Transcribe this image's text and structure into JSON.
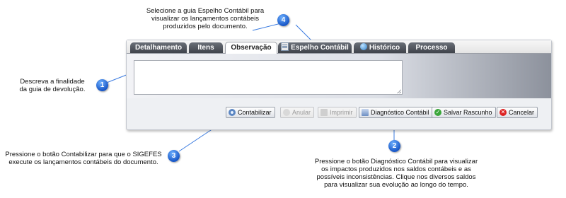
{
  "tabs": [
    {
      "label": "Detalhamento",
      "icon": "",
      "active": false
    },
    {
      "label": "Itens",
      "icon": "",
      "active": false
    },
    {
      "label": "Observação",
      "icon": "",
      "active": true
    },
    {
      "label": "Espelho Contábil",
      "icon": "document-list-icon",
      "active": false
    },
    {
      "label": "Histórico",
      "icon": "globe-icon",
      "active": false
    },
    {
      "label": "Processo",
      "icon": "",
      "active": false
    }
  ],
  "observation": {
    "value": ""
  },
  "buttons": {
    "contabilizar": "Contabilizar",
    "anular": "Anular",
    "imprimir": "Imprimir",
    "diagnostico": "Diagnóstico Contábil",
    "salvar_rascunho": "Salvar Rascunho",
    "cancelar": "Cancelar"
  },
  "callouts": {
    "c1": {
      "number": "1",
      "text_1": "Descreva a finalidade",
      "text_2": "da guia de devolução."
    },
    "c2": {
      "number": "2",
      "text_1": "Pressione o botão Diagnóstico Contábil para visualizar",
      "text_2": "os impactos produzidos nos saldos contábeis e as",
      "text_3": "possíveis inconsistências. Clique nos diversos saldos",
      "text_4": "para visualizar sua evolução ao longo do tempo."
    },
    "c3": {
      "number": "3",
      "text_1": "Pressione o botão Contabilizar para que o SIGEFES",
      "text_2": "execute os lançamentos contábeis do documento."
    },
    "c4": {
      "number": "4",
      "text_1": "Selecione a guia Espelho Contábil para",
      "text_2": "visualizar os lançamentos contábeis",
      "text_3": "produzidos pelo documento."
    }
  },
  "colors": {
    "badge": "#2f6fe0",
    "tab_dark": "#4a4e56",
    "line": "#2f6fe0"
  }
}
